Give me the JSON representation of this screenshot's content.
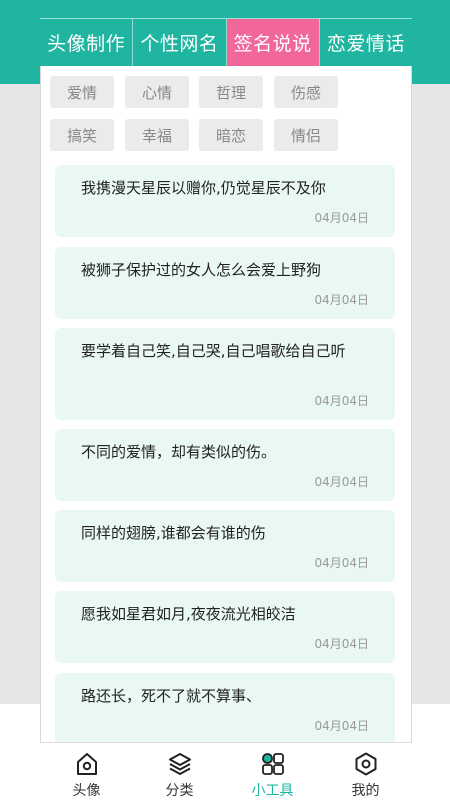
{
  "top_tabs": [
    "头像制作",
    "个性网名",
    "签名说说",
    "恋爱情话"
  ],
  "active_tab_index": 2,
  "tags": [
    "爱情",
    "心情",
    "哲理",
    "伤感",
    "搞笑",
    "幸福",
    "暗恋",
    "情侣"
  ],
  "posts": [
    {
      "text": "我携漫天星辰以赠你,仍觉星辰不及你",
      "date": "04月04日"
    },
    {
      "text": "被狮子保护过的女人怎么会爱上野狗",
      "date": "04月04日"
    },
    {
      "text": "要学着自己笑,自己哭,自己唱歌给自己听",
      "date": "04月04日"
    },
    {
      "text": "不同的爱情，却有类似的伤。",
      "date": "04月04日"
    },
    {
      "text": "同样的翅膀,谁都会有谁的伤",
      "date": "04月04日"
    },
    {
      "text": "愿我如星君如月,夜夜流光相皎洁",
      "date": "04月04日"
    },
    {
      "text": "路还长，死不了就不算事、",
      "date": "04月04日"
    }
  ],
  "bottom_nav": [
    {
      "label": "头像",
      "icon": "home-icon"
    },
    {
      "label": "分类",
      "icon": "layers-icon"
    },
    {
      "label": "小工具",
      "icon": "grid-icon",
      "active": true
    },
    {
      "label": "我的",
      "icon": "hexagon-icon"
    }
  ],
  "colors": {
    "accent": "#1fb5a0",
    "active_tab": "#f2679a",
    "card_bg": "#e9f8f5"
  }
}
